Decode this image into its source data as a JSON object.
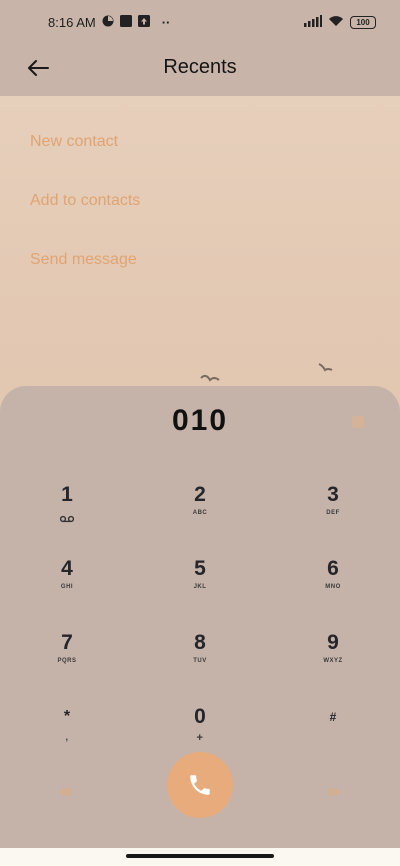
{
  "status_bar": {
    "time": "8:16 AM",
    "notification_icons": [
      "clock-pie-icon",
      "square-app-icon",
      "upload-app-icon",
      "more-dots-icon"
    ],
    "more_label": "··",
    "battery": "100"
  },
  "app_bar": {
    "title": "Recents"
  },
  "actions": [
    {
      "label": "New contact"
    },
    {
      "label": "Add to contacts"
    },
    {
      "label": "Send message"
    }
  ],
  "dialpad": {
    "number": "010",
    "keys": [
      {
        "digit": "1",
        "letters": ""
      },
      {
        "digit": "2",
        "letters": "ABC"
      },
      {
        "digit": "3",
        "letters": "DEF"
      },
      {
        "digit": "4",
        "letters": "GHI"
      },
      {
        "digit": "5",
        "letters": "JKL"
      },
      {
        "digit": "6",
        "letters": "MNO"
      },
      {
        "digit": "7",
        "letters": "PQRS"
      },
      {
        "digit": "8",
        "letters": "TUV"
      },
      {
        "digit": "9",
        "letters": "WXYZ"
      },
      {
        "digit": "*",
        "letters": ","
      },
      {
        "digit": "0",
        "letters": "+"
      },
      {
        "digit": "#",
        "letters": ""
      }
    ]
  },
  "colors": {
    "accent": "#e8ab7b",
    "action_text": "#e0a472",
    "dialpad_bg": "#c5b3aa"
  }
}
